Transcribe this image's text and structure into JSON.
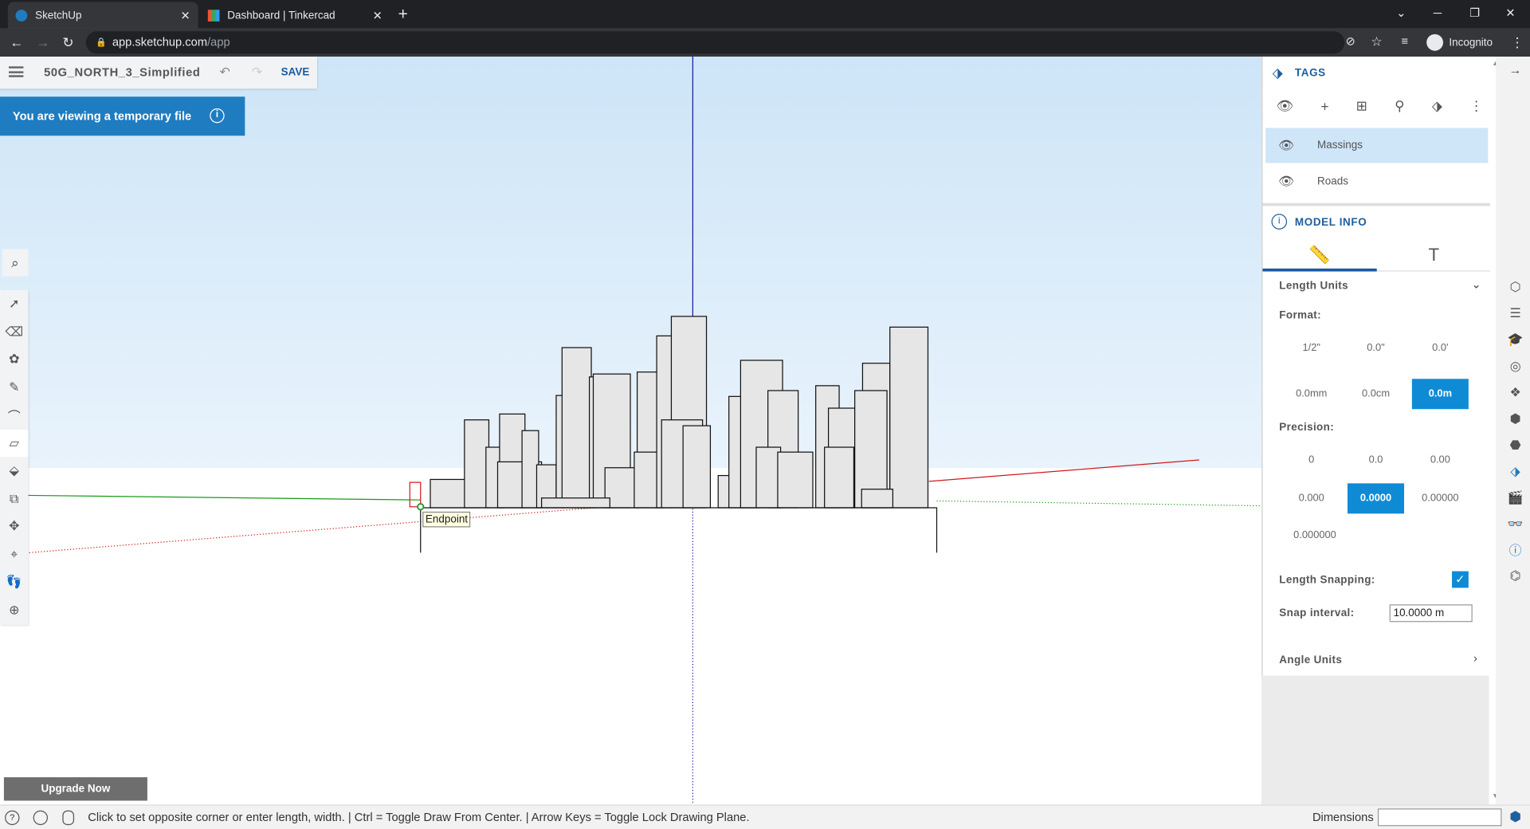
{
  "browser": {
    "tabs": [
      {
        "label": "SketchUp",
        "close": "✕"
      },
      {
        "label": "Dashboard | Tinkercad",
        "close": "✕"
      }
    ],
    "new_tab": "+",
    "url_host": "app.sketchup.com",
    "url_path": "/app",
    "incognito_label": "Incognito"
  },
  "file": {
    "name": "50G_NORTH_3_Simplified",
    "save_label": "SAVE"
  },
  "banner": {
    "text": "You are viewing a temporary file",
    "info": "i"
  },
  "viewport": {
    "tooltip": "Endpoint"
  },
  "upgrade_label": "Upgrade Now",
  "status": {
    "message": "Click to set opposite corner or enter length, width. | Ctrl = Toggle Draw From Center. | Arrow Keys = Toggle Lock Drawing Plane.",
    "dimensions_label": "Dimensions"
  },
  "tags": {
    "title": "TAGS",
    "rows": [
      {
        "name": "Massings"
      },
      {
        "name": "Roads"
      }
    ]
  },
  "model_info": {
    "title": "MODEL INFO",
    "length_units_label": "Length Units",
    "format_label": "Format:",
    "formats": [
      "1/2\"",
      "0.0\"",
      "0.0'",
      "0.0mm",
      "0.0cm",
      "0.0m"
    ],
    "precision_label": "Precision:",
    "precisions": [
      "0",
      "0.0",
      "0.00",
      "0.000",
      "0.0000",
      "0.00000",
      "0.000000"
    ],
    "length_snapping_label": "Length Snapping:",
    "snap_interval_label": "Snap interval:",
    "snap_interval_value": "10.0000 m",
    "angle_units_label": "Angle Units"
  },
  "colors": {
    "accent": "#0f8bd6",
    "banner": "#1f7cc1",
    "chrome": "#202124",
    "sky": "#cde5f7"
  }
}
